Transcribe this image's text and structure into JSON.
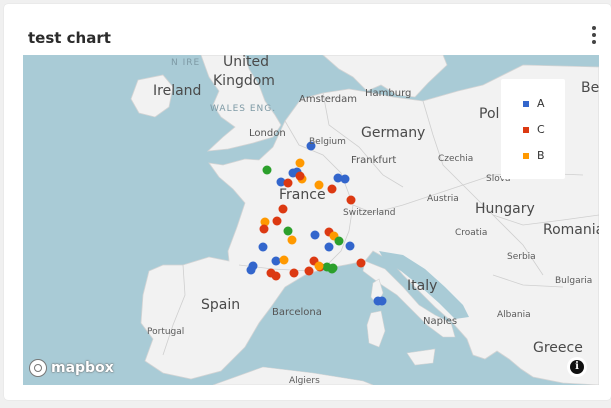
{
  "card": {
    "title": "test chart"
  },
  "legend": [
    {
      "label": "A",
      "color": "#3366cc"
    },
    {
      "label": "C",
      "color": "#dc3912"
    },
    {
      "label": "B",
      "color": "#ff9900"
    }
  ],
  "map": {
    "countries": [
      "Ireland",
      "United Kingdom",
      "Germany",
      "France",
      "Spain",
      "Italy",
      "Pol",
      "Be",
      "Hungary",
      "Romania",
      "Greece"
    ],
    "cities": [
      "London",
      "Amsterdam",
      "Hamburg",
      "Belgium",
      "Frankfurt",
      "Czechia",
      "Austria",
      "Switzerland",
      "Croatia",
      "Serbia",
      "Bulgaria",
      "Albania",
      "Barcelona",
      "Portugal",
      "Naples",
      "Algiers",
      "Slova",
      "N IRE",
      "WALES ENG."
    ],
    "attribution": "mapbox"
  }
}
